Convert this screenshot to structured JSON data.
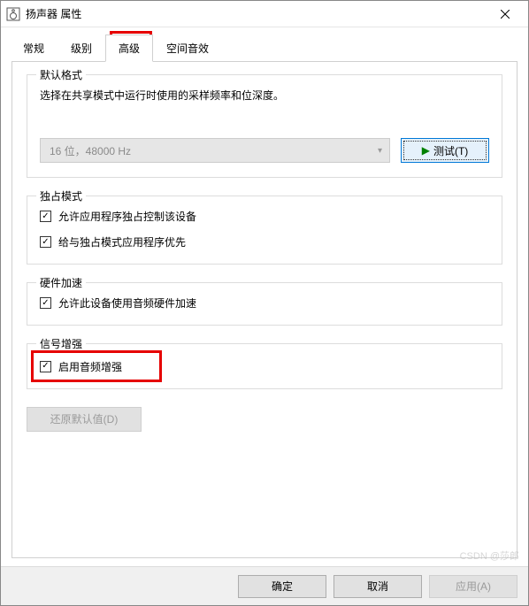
{
  "window": {
    "title": "扬声器 属性"
  },
  "tabs": {
    "general": "常规",
    "levels": "级别",
    "advanced": "高级",
    "spatial": "空间音效"
  },
  "defaultFormat": {
    "title": "默认格式",
    "desc": "选择在共享模式中运行时使用的采样频率和位深度。",
    "combo_value": "16 位，48000 Hz",
    "test_label": "测试(T)"
  },
  "exclusive": {
    "title": "独占模式",
    "allow_control": "允许应用程序独占控制该设备",
    "give_priority": "给与独占模式应用程序优先"
  },
  "hardware": {
    "title": "硬件加速",
    "allow_hw": "允许此设备使用音频硬件加速"
  },
  "enhance": {
    "title": "信号增强",
    "enable": "启用音频增强"
  },
  "restore": {
    "label": "还原默认值(D)"
  },
  "buttons": {
    "ok": "确定",
    "cancel": "取消",
    "apply": "应用(A)"
  },
  "watermark": "CSDN @莎郎"
}
